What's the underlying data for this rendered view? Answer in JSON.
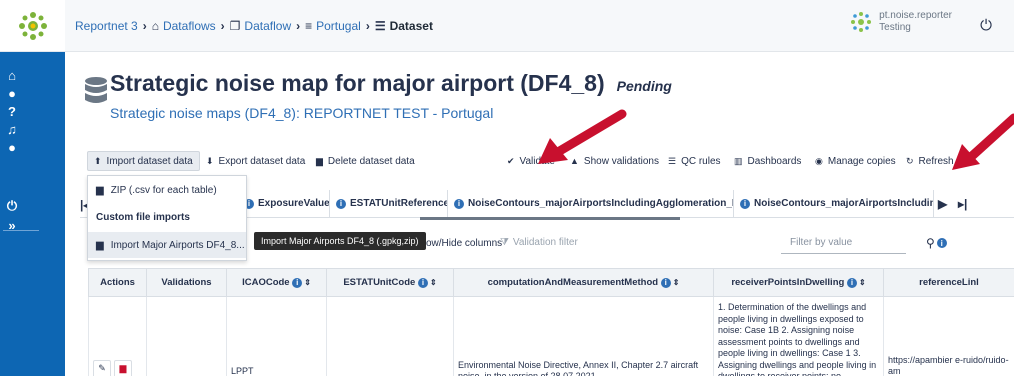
{
  "colors": {
    "sidebar": "#0d66b3",
    "link": "#2f6fb5",
    "text": "#26324d",
    "arrow": "#c8102e"
  },
  "breadcrumb": [
    {
      "label": "Reportnet 3",
      "icon": ""
    },
    {
      "label": "Dataflows",
      "icon": "home-icon"
    },
    {
      "label": "Dataflow",
      "icon": "clone-icon"
    },
    {
      "label": "Portugal",
      "icon": "country-icon"
    },
    {
      "label": "Dataset",
      "icon": "database-icon"
    }
  ],
  "user": {
    "name": "pt.noise.reporter",
    "role": "Testing"
  },
  "dataset": {
    "title": "Strategic noise map for major airport (DF4_8)",
    "status": "Pending",
    "subtitle": "Strategic noise maps (DF4_8): REPORTNET TEST - Portugal"
  },
  "toolbar": {
    "import": "Import dataset data",
    "export": "Export dataset data",
    "delete": "Delete dataset data",
    "validate": "Validate",
    "show_validations": "Show validations",
    "qc_rules": "QC rules",
    "dashboards": "Dashboards",
    "manage_copies": "Manage copies",
    "refresh": "Refresh"
  },
  "import_menu": {
    "zip": "ZIP (.csv for each table)",
    "custom_header": "Custom file imports",
    "custom_item": "Import Major Airports DF4_8...",
    "tooltip": "Import Major Airports DF4_8 (.gpkg,zip)"
  },
  "tabs": [
    "ExposureValue",
    "ESTATUnitReference",
    "NoiseContours_majorAirportsIncludingAgglomeration_Lden",
    "NoiseContours_majorAirportsIncludingAg"
  ],
  "filters": {
    "columns_label": "ow/Hide columns",
    "validation_filter": "Validation filter",
    "search_placeholder": "Filter by value"
  },
  "table": {
    "headers": [
      "Actions",
      "Validations",
      "ICAOCode",
      "ESTATUnitCode",
      "computationAndMeasurementMethod",
      "receiverPointsInDwelling",
      "referenceLinl"
    ],
    "row": {
      "icao": "LPPT",
      "method": "Environmental Noise Directive, Annex II, Chapter 2.7 aircraft noise, in the version of 28.07.2021",
      "receiver": "1. Determination of the dwellings and people living in dwellings exposed to noise: Case 1B 2. Assigning noise assessment points to dwellings and people living in dwellings: Case 1 3. Assigning dwellings and people living in dwellings to receiver points: no",
      "reference": "https://apambier e-ruido/ruido-am"
    }
  }
}
